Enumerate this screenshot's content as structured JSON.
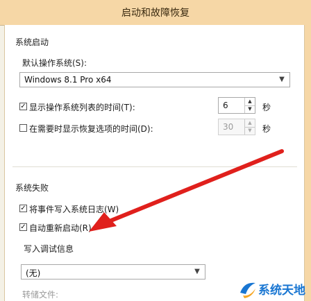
{
  "window": {
    "title": "启动和故障恢复"
  },
  "system_startup": {
    "group_label": "系统启动",
    "default_os_label": "默认操作系统(S):",
    "default_os_value": "Windows 8.1 Pro x64",
    "show_os_list": {
      "checked": true,
      "label": "显示操作系统列表的时间(T):",
      "value": "6",
      "unit": "秒"
    },
    "show_recovery": {
      "checked": false,
      "label": "在需要时显示恢复选项的时间(D):",
      "value": "30",
      "unit": "秒"
    }
  },
  "system_failure": {
    "group_label": "系统失败",
    "write_event": {
      "checked": true,
      "label": "将事件写入系统日志(W)"
    },
    "auto_restart": {
      "checked": true,
      "label": "自动重新启动(R)"
    },
    "debug_info_label": "写入调试信息",
    "debug_info_value": "(无)",
    "dump_file_label": "转储文件:"
  },
  "icons": {
    "checkbox_checked": "checkmark-icon",
    "dropdown": "chevron-down-icon",
    "spin_up": "triangle-up-icon",
    "spin_down": "triangle-down-icon",
    "annotation": "red-arrow-icon",
    "watermark_logo": "swoosh-logo-icon"
  },
  "watermark": {
    "text": "系统天地"
  },
  "colors": {
    "title_bar": "#f6d7a6",
    "annotation_arrow": "#e0201c",
    "watermark_text": "#1976d2"
  }
}
